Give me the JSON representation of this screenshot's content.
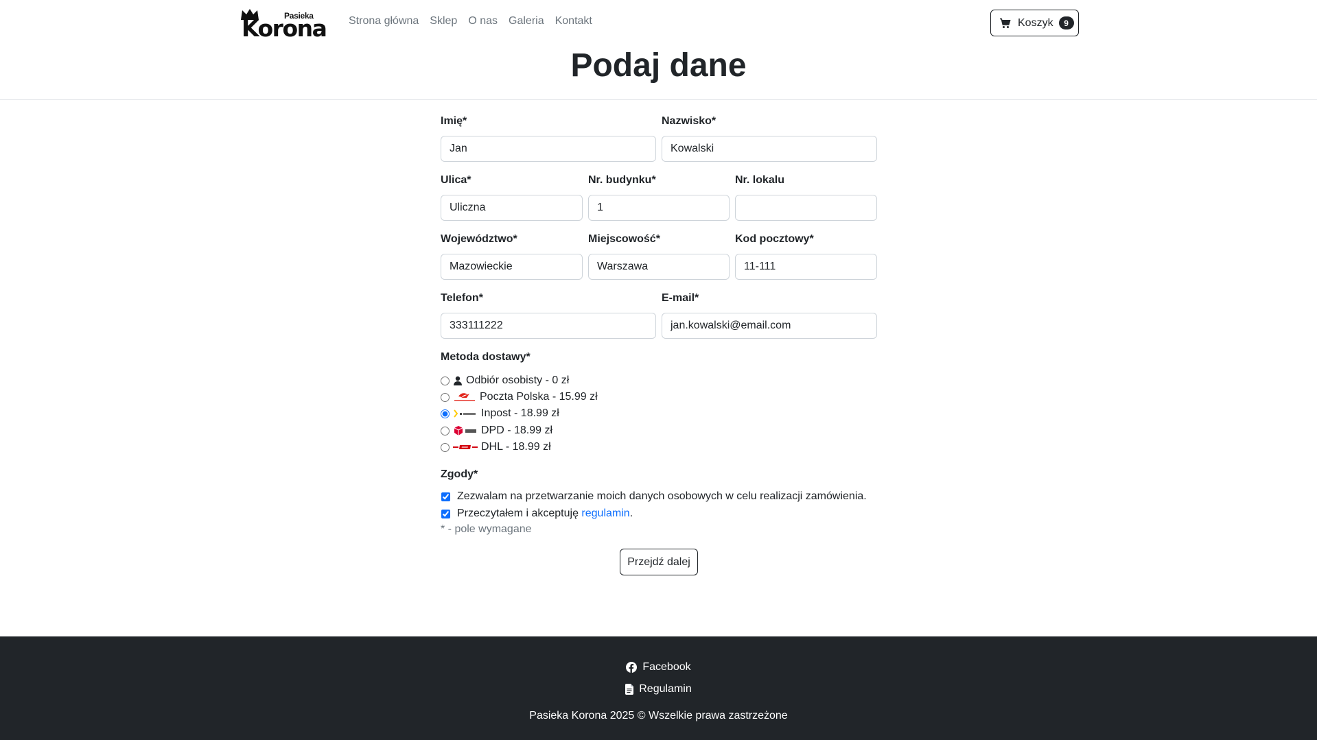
{
  "brand": {
    "sub": "Pasieka",
    "name": "Korona"
  },
  "nav": {
    "items": [
      "Strona główna",
      "Sklep",
      "O nas",
      "Galeria",
      "Kontakt"
    ]
  },
  "cart": {
    "label": "Koszyk",
    "count": "9",
    "icon": "cart-icon"
  },
  "page": {
    "title": "Podaj dane"
  },
  "form": {
    "first_name": {
      "label": "Imię*",
      "value": "Jan"
    },
    "last_name": {
      "label": "Nazwisko*",
      "value": "Kowalski"
    },
    "street": {
      "label": "Ulica*",
      "value": "Uliczna"
    },
    "building_no": {
      "label": "Nr. budynku*",
      "value": "1"
    },
    "apartment_no": {
      "label": "Nr. lokalu",
      "value": ""
    },
    "voivodeship": {
      "label": "Województwo*",
      "value": "Mazowieckie"
    },
    "city": {
      "label": "Miejscowość*",
      "value": "Warszawa"
    },
    "postal_code": {
      "label": "Kod pocztowy*",
      "value": "11-111"
    },
    "phone": {
      "label": "Telefon*",
      "value": "333111222"
    },
    "email": {
      "label": "E-mail*",
      "value": "jan.kowalski@email.com"
    }
  },
  "shipping": {
    "label": "Metoda dostawy*",
    "selected": "Inpost - 18.99 zł",
    "options": [
      {
        "text": "Odbiór osobisty - 0 zł",
        "icon": "person-icon"
      },
      {
        "text": "Poczta Polska - 15.99 zł",
        "icon": "poczta-polska-logo"
      },
      {
        "text": "Inpost - 18.99 zł",
        "icon": "inpost-logo"
      },
      {
        "text": "DPD - 18.99 zł",
        "icon": "dpd-logo"
      },
      {
        "text": "DHL - 18.99 zł",
        "icon": "dhl-logo"
      }
    ]
  },
  "consents": {
    "label": "Zgody*",
    "data_processing": "Zezwalam na przetwarzanie moich danych osobowych w celu realizacji zamówienia.",
    "terms_prefix": "Przeczytałem i akceptuję",
    "terms_link": "regulamin",
    "terms_suffix": ".",
    "required_note": "* - pole wymagane"
  },
  "actions": {
    "next": "Przejdź dalej"
  },
  "footer": {
    "facebook": "Facebook",
    "terms": "Regulamin",
    "copyright": "Pasieka Korona 2025 © Wszelkie prawa zastrzeżone"
  },
  "colors": {
    "footer_bg": "#212529",
    "link": "#0d6efd",
    "muted": "#6c757d"
  }
}
